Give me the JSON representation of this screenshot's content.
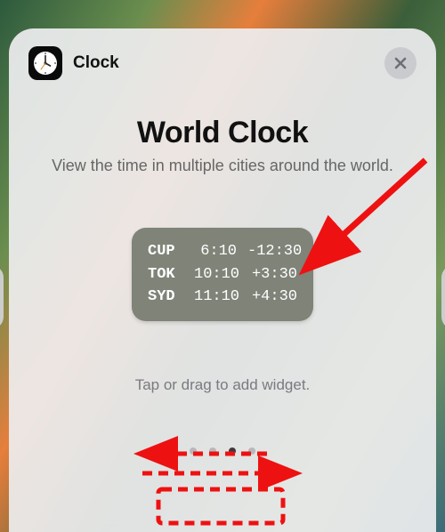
{
  "header": {
    "app_name": "Clock",
    "icon": "clock-icon",
    "close_icon": "close-icon"
  },
  "title": "World Clock",
  "subtitle": "View the time in multiple cities around the world.",
  "widget": {
    "rows": [
      {
        "city": "CUP",
        "time": "6:10",
        "offset": "-12:30"
      },
      {
        "city": "TOK",
        "time": "10:10",
        "offset": "+3:30"
      },
      {
        "city": "SYD",
        "time": "11:10",
        "offset": "+4:30"
      }
    ]
  },
  "hint": "Tap or drag to add widget.",
  "pager": {
    "count": 4,
    "active": 2
  },
  "colors": {
    "annotation": "#e11"
  }
}
